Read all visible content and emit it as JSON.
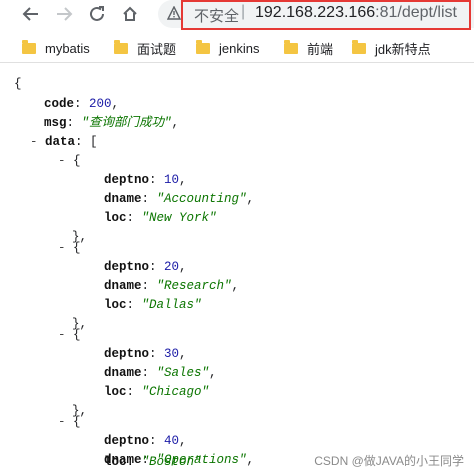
{
  "browser": {
    "insecure_label": "不安全",
    "url_host": "192.168.223.166",
    "url_port_path": ":81/dept/list"
  },
  "bookmarks": [
    {
      "label": "mybatis"
    },
    {
      "label": "面试题"
    },
    {
      "label": "jenkins"
    },
    {
      "label": "前端"
    },
    {
      "label": "jdk新特点"
    }
  ],
  "json_view": {
    "code_key": "code",
    "code_value": "200",
    "msg_key": "msg",
    "msg_value": "\"查询部门成功\"",
    "data_key": "data",
    "depts": [
      {
        "deptno": "10",
        "dname": "\"Accounting\"",
        "loc": "\"New York\""
      },
      {
        "deptno": "20",
        "dname": "\"Research\"",
        "loc": "\"Dallas\""
      },
      {
        "deptno": "30",
        "dname": "\"Sales\"",
        "loc": "\"Chicago\""
      },
      {
        "deptno": "40",
        "dname": "\"Operations\"",
        "loc": "\"Boston\""
      }
    ]
  },
  "watermark": "CSDN @做JAVA的小王同学"
}
